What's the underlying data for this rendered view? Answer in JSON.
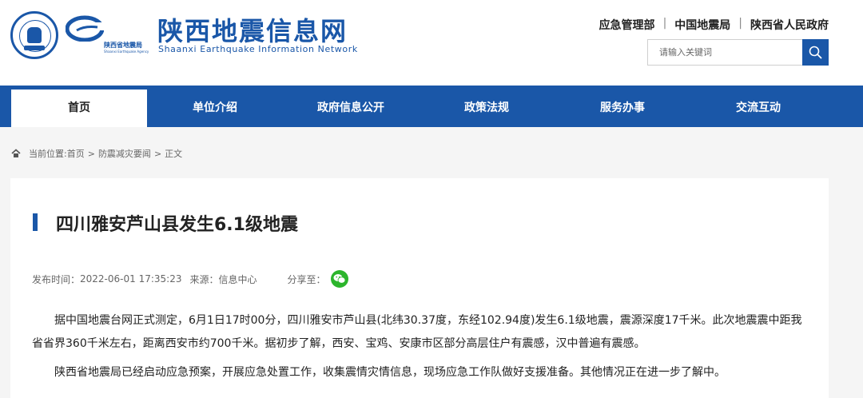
{
  "site": {
    "title": "陕西地震信息网",
    "subtitle": "Shaanxi Earthquake Information Network",
    "sub_logo_text": "陕西省地震局",
    "sub_logo_en": "Shaanxi Earthquake Agency"
  },
  "top_links": [
    "应急管理部",
    "中国地震局",
    "陕西省人民政府"
  ],
  "search": {
    "placeholder": "请输入关键词"
  },
  "nav": [
    {
      "label": "首页",
      "active": true
    },
    {
      "label": "单位介绍",
      "active": false
    },
    {
      "label": "政府信息公开",
      "active": false
    },
    {
      "label": "政策法规",
      "active": false
    },
    {
      "label": "服务办事",
      "active": false
    },
    {
      "label": "交流互动",
      "active": false
    }
  ],
  "breadcrumb": {
    "prefix": "当前位置:",
    "items": [
      "首页",
      "防震减灾要闻",
      "正文"
    ]
  },
  "article": {
    "title": "四川雅安芦山县发生6.1级地震",
    "publish_time_label": "发布时间：",
    "publish_time": "2022-06-01 17:35:23",
    "source_label": "来源：",
    "source": "信息中心",
    "share_label": "分享至：",
    "paragraphs": [
      "据中国地震台网正式测定，6月1日17时00分，四川雅安市芦山县(北纬30.37度，东经102.94度)发生6.1级地震，震源深度17千米。此次地震震中距我省省界360千米左右，距离西安市约700千米。据初步了解，西安、宝鸡、安康市区部分高层住户有震感，汉中普遍有震感。",
      "陕西省地震局已经启动应急预案，开展应急处置工作，收集震情灾情信息，现场应急工作队做好支援准备。其他情况正在进一步了解中。"
    ]
  },
  "colors": {
    "brand_blue": "#1a57a8",
    "wechat_green": "#2cb52c",
    "background": "#f5f5f5"
  },
  "icons": [
    "emblem-logo",
    "earthquake-agency-logo",
    "search-icon",
    "home-icon",
    "wechat-icon"
  ]
}
